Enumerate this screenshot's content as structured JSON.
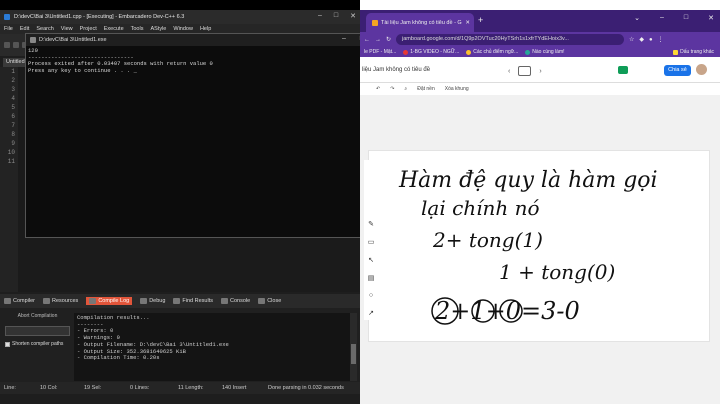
{
  "devcpp": {
    "title": "D:\\devC\\Bai 3\\Untitled1.cpp - [Executing] - Embarcadero Dev-C++ 6.3",
    "menu": [
      "File",
      "Edit",
      "Search",
      "View",
      "Project",
      "Execute",
      "Tools",
      "AStyle",
      "Window",
      "Help"
    ],
    "editor_tab": "Untitled",
    "line_numbers": [
      "1",
      "2",
      "3",
      "4",
      "5",
      "6",
      "7",
      "8",
      "9",
      "10",
      "11"
    ],
    "console": {
      "title": "D:\\devC\\Bai 3\\Untitled1.exe",
      "lines": [
        "120",
        "--------------------------------",
        "Process exited after 0.03407 seconds with return value 0",
        "Press any key to continue . . . _"
      ]
    },
    "bottom_tabs": [
      "Compiler",
      "Resources",
      "Compile Log",
      "Debug",
      "Find Results",
      "Console",
      "Close"
    ],
    "active_bottom_tab": "Compile Log",
    "abort_label": "Abort Compilation",
    "shorten_label": "Shorten compiler paths",
    "compile_results": [
      "Compilation results...",
      "--------",
      "- Errors: 0",
      "- Warnings: 0",
      "- Output Filename: D:\\devC\\Bai 3\\Untitled1.exe",
      "- Output Size: 352.3681640625 KiB",
      "- Compilation Time: 0.20s"
    ],
    "status": {
      "line": "Line:",
      "col": "10 Col:",
      "sel": "19 Sel:",
      "lines": "0 Lines:",
      "length": "11 Length:",
      "insert": "140 Insert",
      "parse": "Done parsing in 0.032 seconds"
    }
  },
  "chrome": {
    "tab_title": "Tài liệu Jam không có tiêu đề - G",
    "new_tab": "+",
    "url": "jamboard.google.com/d/1Q9p2OVTuc20HyTSrh1s1xfrTYdEHoix3v...",
    "bookmarks": [
      "le PDF - Mật...",
      "1-BG VIDEO - NGỮ...",
      "Các chủ điểm ngữ...",
      "Nào cùng làm!",
      "Dấu trang khác"
    ],
    "jam_title": "liệu Jam không có tiêu đề",
    "share_label": "Chia sẻ",
    "toolbar": [
      "Đặt nền",
      "Xóa khung"
    ],
    "handwriting": [
      "Hàm đệ quy là hàm gọi",
      "lại chính nó",
      "2+ tong(1)",
      "1 + tong(0)",
      "2+1+0=3-0"
    ]
  }
}
